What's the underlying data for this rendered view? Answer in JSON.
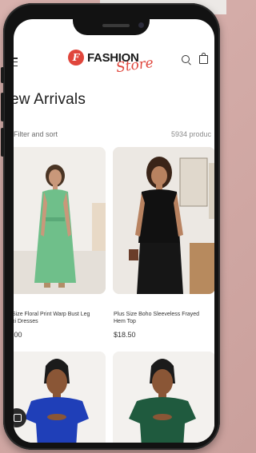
{
  "header": {
    "logo_mark": "F",
    "logo_text": "FASHION",
    "logo_script": "Store"
  },
  "main": {
    "page_title": "ew Arrivals",
    "filter_label": "Filter and sort",
    "product_count": "5934 produc"
  },
  "products": [
    {
      "name_line1": "Size Floral Print Warp Bust Leg",
      "name_line2": "xi Dresses",
      "price": ".00"
    },
    {
      "name_line1": "Plus Size Boho Sleeveless Frayed",
      "name_line2": "Hem Top",
      "price": "$18.50"
    },
    {
      "name_line1": "",
      "name_line2": "",
      "price": ""
    },
    {
      "name_line1": "",
      "name_line2": "",
      "price": ""
    }
  ],
  "colors": {
    "accent": "#e0463c",
    "dress_green": "#6fbf8a",
    "top_black": "#111111",
    "top_blue": "#1f3fb8",
    "top_dark_green": "#1f5a3e",
    "background": "#d9b2ae"
  },
  "icons": [
    "menu-icon",
    "search-icon",
    "cart-icon",
    "chat-icon"
  ]
}
